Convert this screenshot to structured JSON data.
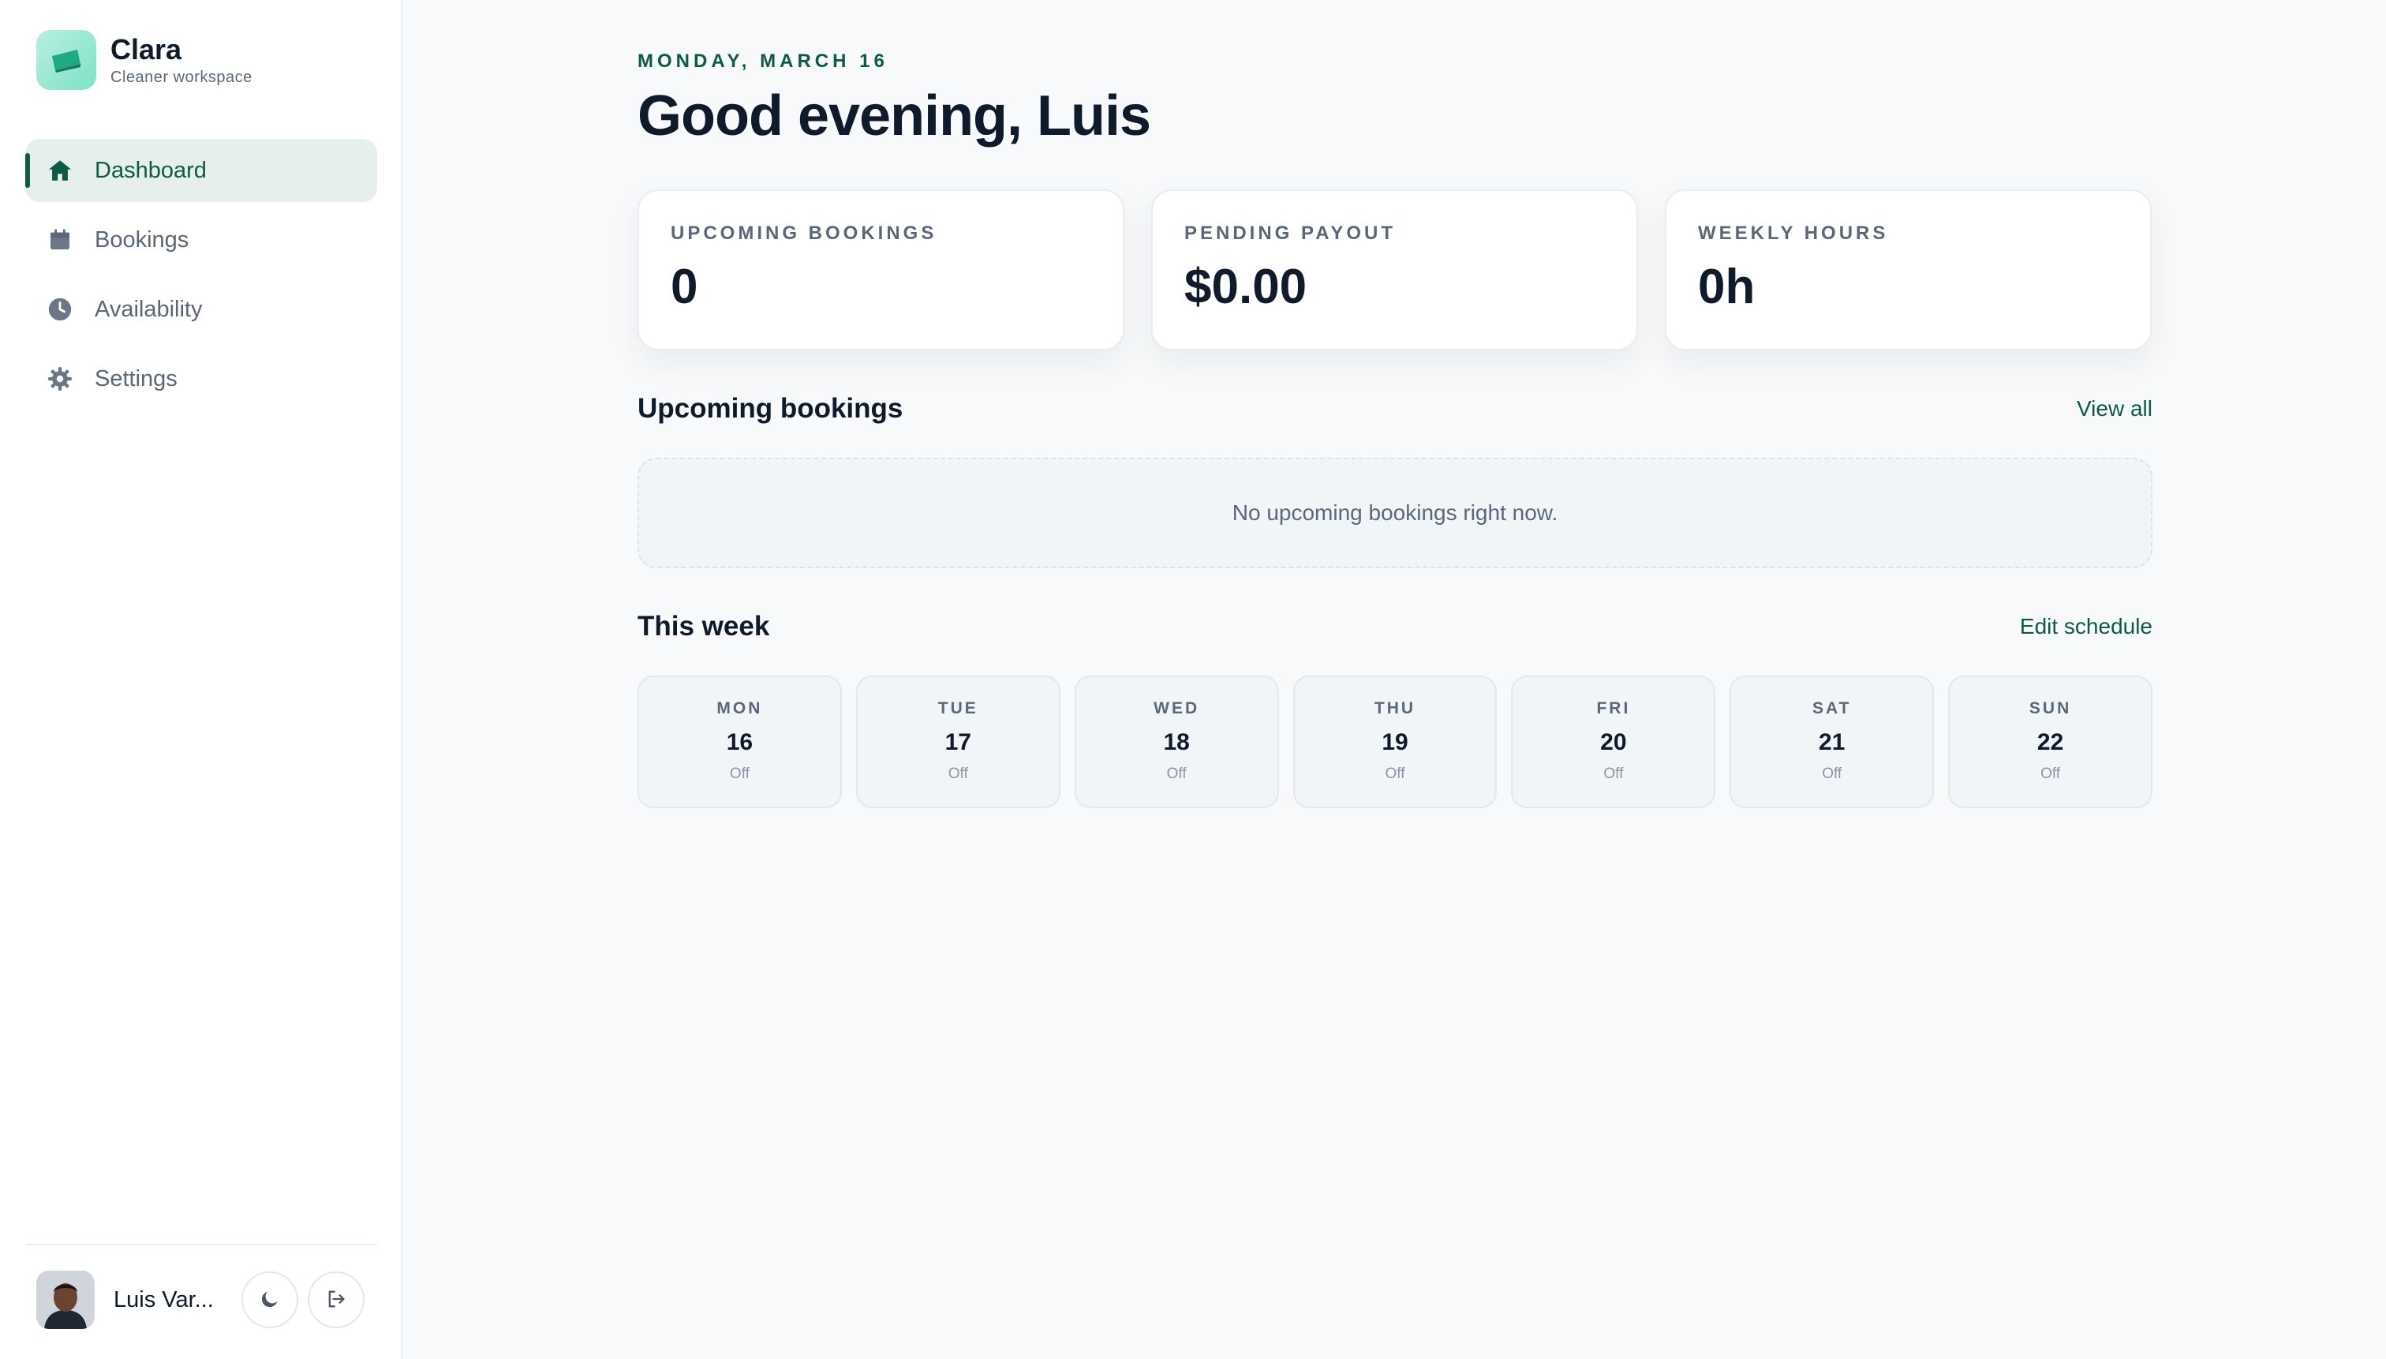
{
  "brand": {
    "name": "Clara",
    "subtitle": "Cleaner workspace",
    "logo_icon": "tray-icon"
  },
  "nav": {
    "items": [
      {
        "label": "Dashboard",
        "icon": "home-icon",
        "active": true
      },
      {
        "label": "Bookings",
        "icon": "calendar-icon",
        "active": false
      },
      {
        "label": "Availability",
        "icon": "clock-icon",
        "active": false
      },
      {
        "label": "Settings",
        "icon": "gear-icon",
        "active": false
      }
    ]
  },
  "user": {
    "name": "Luis Var...",
    "theme_icon": "moon-icon",
    "logout_icon": "logout-icon"
  },
  "header": {
    "date": "MONDAY, MARCH 16",
    "greeting": "Good evening, Luis"
  },
  "stats": [
    {
      "label": "UPCOMING BOOKINGS",
      "value": "0"
    },
    {
      "label": "PENDING PAYOUT",
      "value": "$0.00"
    },
    {
      "label": "WEEKLY HOURS",
      "value": "0h"
    }
  ],
  "bookings": {
    "title": "Upcoming bookings",
    "link": "View all",
    "empty": "No upcoming bookings right now."
  },
  "week": {
    "title": "This week",
    "link": "Edit schedule",
    "days": [
      {
        "name": "MON",
        "num": "16",
        "status": "Off"
      },
      {
        "name": "TUE",
        "num": "17",
        "status": "Off"
      },
      {
        "name": "WED",
        "num": "18",
        "status": "Off"
      },
      {
        "name": "THU",
        "num": "19",
        "status": "Off"
      },
      {
        "name": "FRI",
        "num": "20",
        "status": "Off"
      },
      {
        "name": "SAT",
        "num": "21",
        "status": "Off"
      },
      {
        "name": "SUN",
        "num": "22",
        "status": "Off"
      }
    ]
  },
  "colors": {
    "accent": "#0d5a45",
    "active_bg": "#e7efec",
    "background": "#f7f9fb"
  }
}
